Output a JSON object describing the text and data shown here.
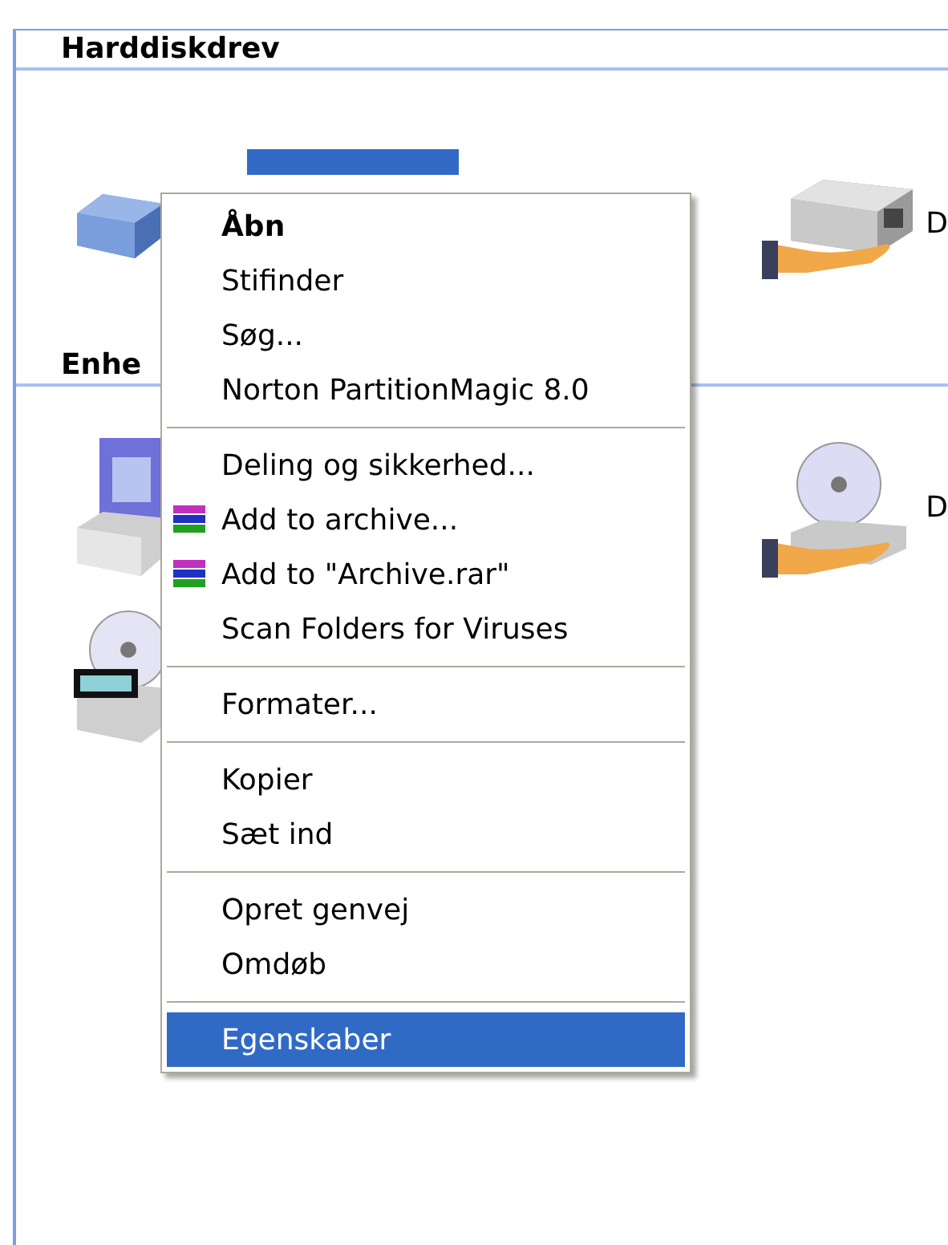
{
  "sections": [
    {
      "title": "Harddiskdrev",
      "items": [
        {
          "kind": "drive",
          "selected": true
        },
        {
          "kind": "shared-drive",
          "label": "D",
          "selected": false
        }
      ]
    },
    {
      "title": "Enhe",
      "items": [
        {
          "kind": "floppy",
          "selected": false
        },
        {
          "kind": "shared-cd",
          "label": "D",
          "selected": false
        },
        {
          "kind": "dvd",
          "selected": false
        }
      ]
    }
  ],
  "context_menu": {
    "groups": [
      [
        {
          "label": "Åbn",
          "kind": "plain",
          "default": true,
          "selected": false
        },
        {
          "label": "Stifinder",
          "kind": "plain",
          "default": false,
          "selected": false
        },
        {
          "label": "Søg...",
          "kind": "plain",
          "default": false,
          "selected": false
        },
        {
          "label": "Norton PartitionMagic 8.0",
          "kind": "plain",
          "default": false,
          "selected": false
        }
      ],
      [
        {
          "label": "Deling og sikkerhed...",
          "kind": "plain",
          "default": false,
          "selected": false
        },
        {
          "label": "Add to archive...",
          "kind": "archive",
          "default": false,
          "selected": false
        },
        {
          "label": "Add to \"Archive.rar\"",
          "kind": "archive",
          "default": false,
          "selected": false
        },
        {
          "label": "Scan Folders for Viruses",
          "kind": "plain",
          "default": false,
          "selected": false
        }
      ],
      [
        {
          "label": "Formater...",
          "default": false,
          "selected": false
        }
      ],
      [
        {
          "label": "Kopier",
          "default": false,
          "selected": false
        },
        {
          "label": "Sæt ind",
          "default": false,
          "selected": false
        }
      ],
      [
        {
          "label": "Opret genvej",
          "default": false,
          "selected": false
        },
        {
          "label": "Omdøb",
          "default": false,
          "selected": false
        }
      ],
      [
        {
          "label": "Egenskaber",
          "default": false,
          "selected": true
        }
      ]
    ]
  }
}
